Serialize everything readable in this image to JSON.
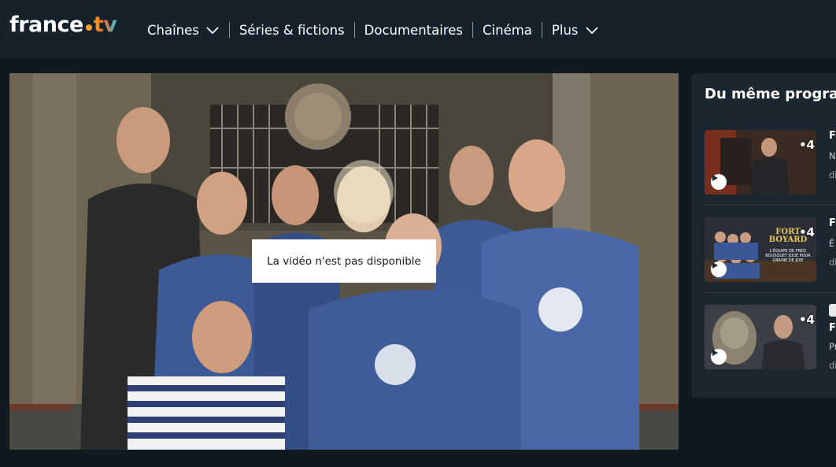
{
  "brand": {
    "logo_text": "france",
    "logo_tv": "tv"
  },
  "nav": {
    "items": [
      {
        "label": "Chaînes",
        "dropdown": true
      },
      {
        "label": "Séries & fictions",
        "dropdown": false
      },
      {
        "label": "Documentaires",
        "dropdown": false
      },
      {
        "label": "Cinéma",
        "dropdown": false
      },
      {
        "label": "Plus",
        "dropdown": true
      }
    ]
  },
  "player": {
    "message": "La vidéo n'est pas disponible"
  },
  "sidebar": {
    "title": "Du même programme",
    "cards": [
      {
        "badge": "•4",
        "title": "Fo",
        "sub": "N",
        "meta": "di",
        "play_icon": "play-icon"
      },
      {
        "badge": "•4",
        "title": "Fo",
        "sub": "É",
        "meta": "di",
        "thumb_text": "FORT BOYARD",
        "thumb_caption": "L'ÉQUIPE DE FRED BOUSQUET JOUE POUR GRAINE DE JOIE",
        "play_icon": "play-icon"
      },
      {
        "badge": "•4",
        "title": "Fo",
        "sub": "Pr",
        "meta": "di",
        "play_icon": "play-icon"
      }
    ]
  },
  "colors": {
    "background": "#101820",
    "header": "#15212b",
    "sidebar": "#1b2730",
    "accent_orange": "#f4a124",
    "accent_blue": "#3dbcd6"
  }
}
